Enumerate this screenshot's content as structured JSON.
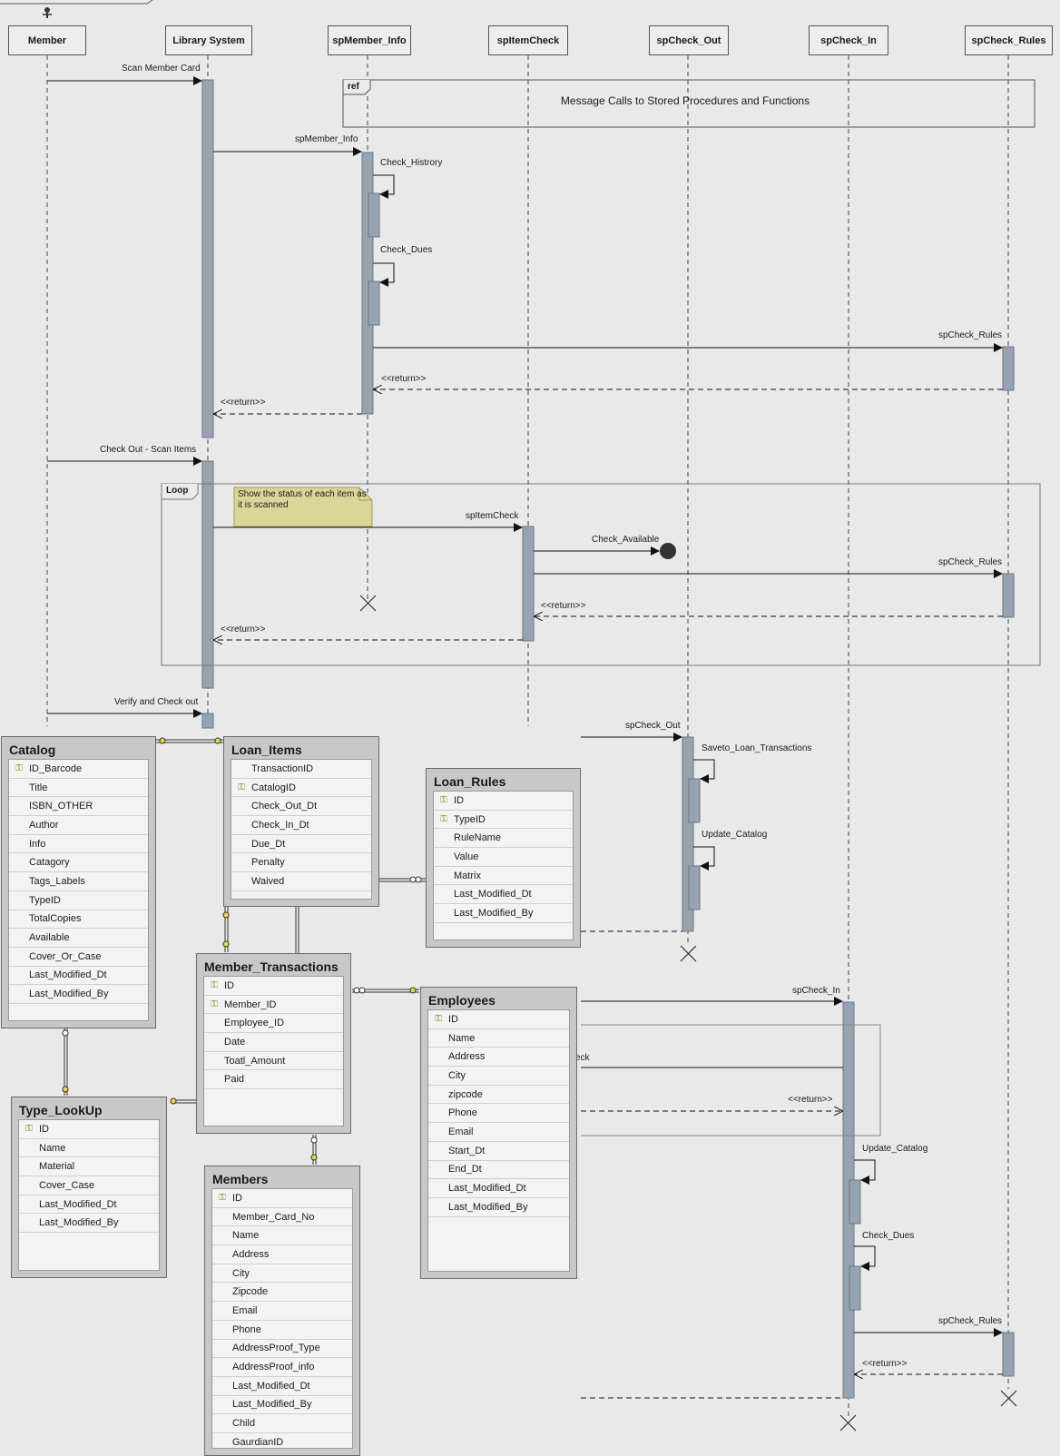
{
  "lifelines": [
    "Member",
    "Library System",
    "spMember_Info",
    "spItemCheck",
    "spCheck_Out",
    "spCheck_In",
    "spCheck_Rules"
  ],
  "ref": {
    "tag": "ref",
    "text": "Message Calls to Stored Procedures and Functions"
  },
  "loop": {
    "tag": "Loop",
    "note": "Show the status of each item as it is scanned"
  },
  "messages": {
    "scan_member_card": "Scan Member Card",
    "sp_member_info": "spMember_Info",
    "check_history": "Check_Histrory",
    "check_dues": "Check_Dues",
    "sp_check_rules": "spCheck_Rules",
    "return": "<<return>>",
    "check_out_scan": "Check Out -  Scan Items",
    "sp_item_check": "spItemCheck",
    "check_available": "Check_Available",
    "verify_check_out": "Verify and Check out",
    "sp_check_out": "spCheck_Out",
    "saveto_loan": "Saveto_Loan_Transactions",
    "update_catalog": "Update_Catalog",
    "sp_check_in": "spCheck_In",
    "partial_check": "eck"
  },
  "tables": {
    "catalog": {
      "title": "Catalog",
      "fields": [
        {
          "name": "ID_Barcode",
          "key": true
        },
        {
          "name": "Title"
        },
        {
          "name": "ISBN_OTHER"
        },
        {
          "name": "Author"
        },
        {
          "name": "Info"
        },
        {
          "name": "Catagory"
        },
        {
          "name": "Tags_Labels"
        },
        {
          "name": "TypeID"
        },
        {
          "name": "TotalCopies"
        },
        {
          "name": "Available"
        },
        {
          "name": "Cover_Or_Case"
        },
        {
          "name": "Last_Modified_Dt"
        },
        {
          "name": "Last_Modified_By"
        }
      ]
    },
    "loan_items": {
      "title": "Loan_Items",
      "fields": [
        {
          "name": "TransactionID"
        },
        {
          "name": "CatalogID",
          "key": true
        },
        {
          "name": "Check_Out_Dt"
        },
        {
          "name": "Check_In_Dt"
        },
        {
          "name": "Due_Dt"
        },
        {
          "name": "Penalty"
        },
        {
          "name": "Waived"
        }
      ]
    },
    "loan_rules": {
      "title": "Loan_Rules",
      "fields": [
        {
          "name": "ID",
          "key": true
        },
        {
          "name": "TypeID",
          "key": true
        },
        {
          "name": "RuleName"
        },
        {
          "name": "Value"
        },
        {
          "name": "Matrix"
        },
        {
          "name": "Last_Modified_Dt"
        },
        {
          "name": "Last_Modified_By"
        }
      ]
    },
    "member_transactions": {
      "title": "Member_Transactions",
      "fields": [
        {
          "name": "ID",
          "key": true
        },
        {
          "name": "Member_ID",
          "key": true
        },
        {
          "name": "Employee_ID"
        },
        {
          "name": "Date"
        },
        {
          "name": "Toatl_Amount"
        },
        {
          "name": "Paid"
        }
      ]
    },
    "employees": {
      "title": "Employees",
      "fields": [
        {
          "name": "ID",
          "key": true
        },
        {
          "name": "Name"
        },
        {
          "name": "Address"
        },
        {
          "name": "City"
        },
        {
          "name": "zipcode"
        },
        {
          "name": "Phone"
        },
        {
          "name": "Email"
        },
        {
          "name": "Start_Dt"
        },
        {
          "name": "End_Dt"
        },
        {
          "name": "Last_Modified_Dt"
        },
        {
          "name": "Last_Modified_By"
        }
      ]
    },
    "type_lookup": {
      "title": "Type_LookUp",
      "fields": [
        {
          "name": "ID",
          "key": true
        },
        {
          "name": "Name"
        },
        {
          "name": "Material"
        },
        {
          "name": "Cover_Case"
        },
        {
          "name": "Last_Modified_Dt"
        },
        {
          "name": "Last_Modified_By"
        }
      ]
    },
    "members": {
      "title": "Members",
      "fields": [
        {
          "name": "ID",
          "key": true
        },
        {
          "name": "Member_Card_No"
        },
        {
          "name": "Name"
        },
        {
          "name": "Address"
        },
        {
          "name": "City"
        },
        {
          "name": "Zipcode"
        },
        {
          "name": "Email"
        },
        {
          "name": "Phone"
        },
        {
          "name": "AddressProof_Type"
        },
        {
          "name": "AddressProof_info"
        },
        {
          "name": "Last_Modified_Dt"
        },
        {
          "name": "Last_Modified_By"
        },
        {
          "name": "Child"
        },
        {
          "name": "GaurdianID"
        }
      ]
    }
  }
}
